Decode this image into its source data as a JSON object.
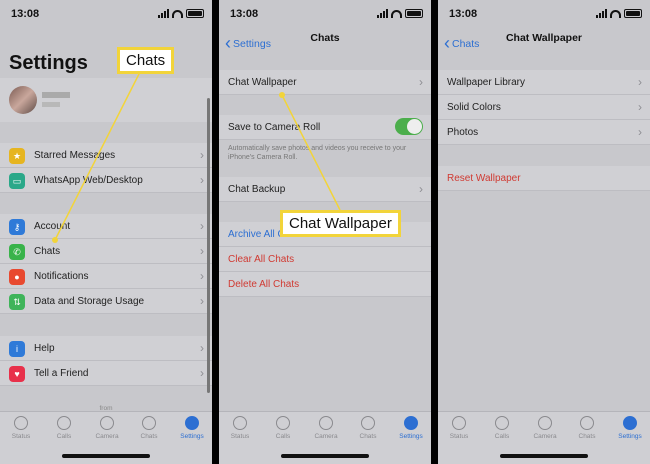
{
  "status_time": "13:08",
  "callouts": {
    "chats": "Chats",
    "chat_wallpaper": "Chat Wallpaper"
  },
  "screen1": {
    "title": "Settings",
    "rows_group1": [
      "Starred Messages",
      "WhatsApp Web/Desktop"
    ],
    "rows_group2": [
      "Account",
      "Chats",
      "Notifications",
      "Data and Storage Usage"
    ],
    "rows_group3": [
      "Help",
      "Tell a Friend"
    ],
    "footer": "from",
    "icons": {
      "starred": "#e6b520",
      "web": "#2aa889",
      "account": "#2f7ad8",
      "chats": "#39b34a",
      "notifications": "#e8492f",
      "data": "#3fb45a",
      "help": "#2f7ad8",
      "tell": "#e8304a"
    }
  },
  "screen2": {
    "back": "Settings",
    "title": "Chats",
    "chat_wallpaper": "Chat Wallpaper",
    "save_camera_roll": "Save to Camera Roll",
    "save_note": "Automatically save photos and videos you receive to your iPhone's Camera Roll.",
    "chat_backup": "Chat Backup",
    "archive_all": "Archive All C",
    "clear_all": "Clear All Chats",
    "delete_all": "Delete All Chats"
  },
  "screen3": {
    "back": "Chats",
    "title": "Chat Wallpaper",
    "rows": [
      "Wallpaper Library",
      "Solid Colors",
      "Photos"
    ],
    "reset": "Reset Wallpaper"
  },
  "tabs": [
    "Status",
    "Calls",
    "Camera",
    "Chats",
    "Settings"
  ],
  "colors": {
    "accent": "#2d6fd2",
    "destructive": "#d03a32",
    "highlight": "#f2d43a"
  }
}
